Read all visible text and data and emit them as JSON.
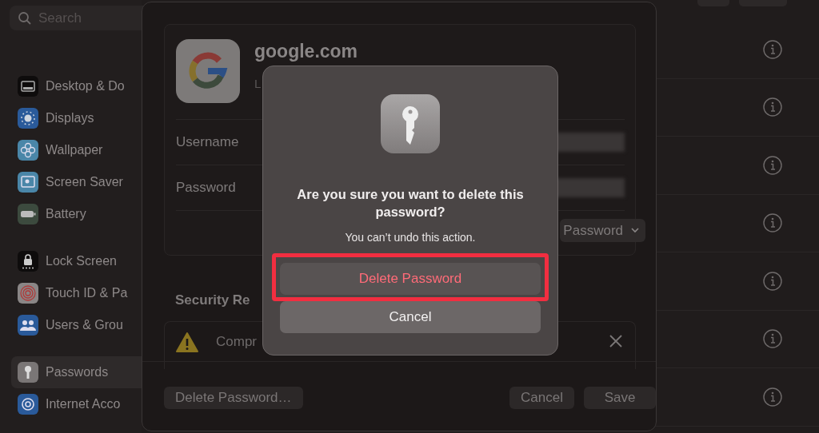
{
  "sidebar": {
    "search": {
      "placeholder": "Search"
    },
    "groups": [
      [
        {
          "label": "Desktop & Do",
          "selected": false
        },
        {
          "label": "Displays",
          "selected": false
        },
        {
          "label": "Wallpaper",
          "selected": false
        },
        {
          "label": "Screen Saver",
          "selected": false
        },
        {
          "label": "Battery",
          "selected": false
        }
      ],
      [
        {
          "label": "Lock Screen",
          "selected": false
        },
        {
          "label": "Touch ID & Pa",
          "selected": false
        },
        {
          "label": "Users & Grou",
          "selected": false
        }
      ],
      [
        {
          "label": "Passwords",
          "selected": true
        },
        {
          "label": "Internet Acco",
          "selected": false
        }
      ]
    ]
  },
  "sheet": {
    "site": {
      "title": "google.com",
      "subtitle": "L"
    },
    "fields": [
      {
        "label": "Username"
      },
      {
        "label": "Password"
      }
    ],
    "popup": {
      "label": "Password"
    },
    "section_title": "Security Re",
    "warning": {
      "title": "Compr"
    },
    "footer_buttons": [
      {
        "label": "Delete Password…",
        "kind": "left"
      },
      {
        "label": "Cancel",
        "kind": "right"
      },
      {
        "label": "Save",
        "kind": "right"
      }
    ]
  },
  "alert": {
    "title": "Are you sure you want to delete this password?",
    "message": "You can’t undo this action.",
    "buttons": [
      {
        "label": "Delete Password",
        "kind": "destructive",
        "highlighted": true
      },
      {
        "label": "Cancel",
        "kind": "default",
        "highlighted": false
      }
    ]
  }
}
